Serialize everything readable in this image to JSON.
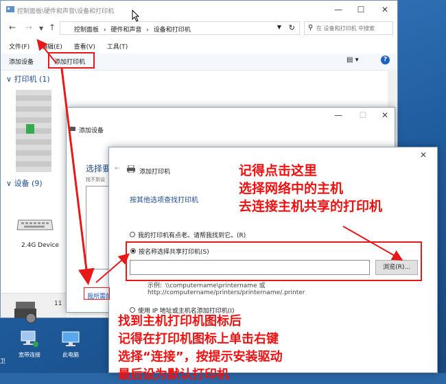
{
  "window": {
    "title": "控制面板\\硬件和声音\\设备和打印机",
    "breadcrumb": [
      "控制面板",
      "硬件和声音",
      "设备和打印机"
    ],
    "search_placeholder": "在 设备和打印机 中搜索",
    "menu": [
      "文件(F)",
      "编辑(E)",
      "查看(V)",
      "工具(T)"
    ],
    "commands": {
      "add_device": "添加设备",
      "add_printer": "添加打印机"
    },
    "sections": {
      "printers": "打印机 (1)",
      "devices": "设备 (9)"
    },
    "device_label": "2.4G Device",
    "counter_fragment": "11"
  },
  "add_device_dialog": {
    "title": "添加设备",
    "heading": "选择要",
    "subtext": "找不到设",
    "link": "我所需的"
  },
  "add_printer_dialog": {
    "title": "添加打印机",
    "heading": "按其他选项查找打印机",
    "option_old": "我的打印机有点老。请帮我找到它。(R)",
    "option_shared": "按名称选择共享打印机(S)",
    "shared_value": "",
    "browse_label": "浏览(R)...",
    "example_prefix": "示例:",
    "example_1": "\\\\computername\\printername 或",
    "example_2": "http://computername/printers/printername/.printer",
    "option_ip": "使用 IP 地址或主机名添加打印机(I)"
  },
  "annotations": {
    "top_right": [
      "记得点击这里",
      "选择网络中的主机",
      "去连接主机共享的打印机"
    ],
    "bottom": [
      "找到主机打印机图标后",
      "记得在打印机图标上单击右键",
      "选择“连接”，按提示安装驱动",
      "最后设为默认打印机"
    ]
  },
  "desktop": {
    "icons": [
      "宽带连接",
      "此电脑"
    ],
    "left_fragment": "卫"
  },
  "colors": {
    "annotation": "#f01010",
    "link": "#1a56c4",
    "section": "#1d4b8e"
  }
}
